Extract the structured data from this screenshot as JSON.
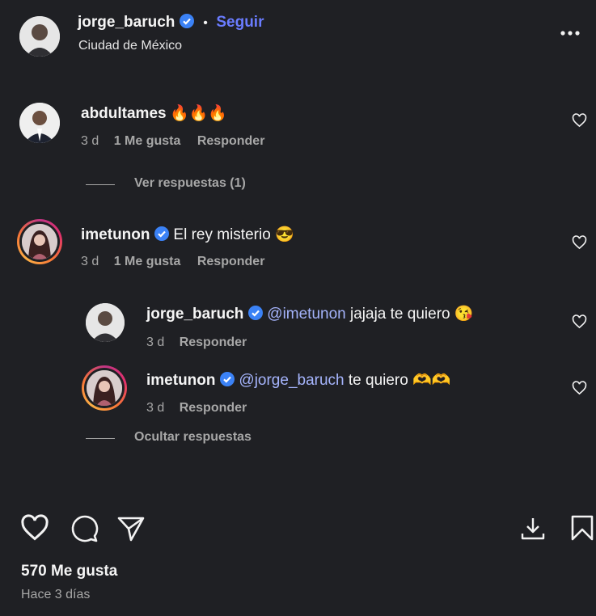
{
  "header": {
    "username": "jorge_baruch",
    "dot": "•",
    "follow_label": "Seguir",
    "location": "Ciudad de México",
    "more_label": "•••"
  },
  "comments": [
    {
      "username": "abdultames",
      "text": "🔥🔥🔥",
      "time": "3 d",
      "likes": "1 Me gusta",
      "reply": "Responder",
      "view_replies": "Ver respuestas (1)"
    },
    {
      "username": "imetunon",
      "text": "El rey misterio 😎",
      "time": "3 d",
      "likes": "1 Me gusta",
      "reply": "Responder",
      "replies": [
        {
          "username": "jorge_baruch",
          "mention": "@imetunon",
          "text": " jajaja te quiero 😘",
          "time": "3 d",
          "reply": "Responder"
        },
        {
          "username": "imetunon",
          "mention": "@jorge_baruch",
          "text": " te quiero 🫶🫶",
          "time": "3 d",
          "reply": "Responder"
        }
      ],
      "hide_replies": "Ocultar respuestas"
    }
  ],
  "footer": {
    "likes": "570 Me gusta",
    "date": "Hace 3 días"
  },
  "colors": {
    "background": "#1f2024",
    "accent": "#6a7cff",
    "muted": "#a7a7a7",
    "verified": "#3b82f6"
  }
}
